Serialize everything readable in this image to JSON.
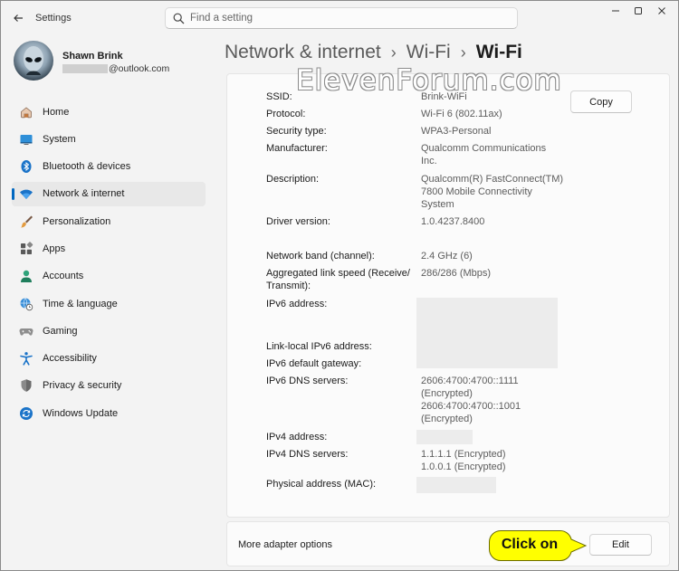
{
  "app": {
    "title": "Settings",
    "search_placeholder": "Find a setting"
  },
  "profile": {
    "name": "Shawn Brink",
    "email_suffix": "@outlook.com"
  },
  "sidebar": {
    "active_index": 3,
    "items": [
      {
        "label": "Home",
        "icon": "home-icon"
      },
      {
        "label": "System",
        "icon": "system-icon"
      },
      {
        "label": "Bluetooth & devices",
        "icon": "bluetooth-icon"
      },
      {
        "label": "Network & internet",
        "icon": "wifi-icon"
      },
      {
        "label": "Personalization",
        "icon": "brush-icon"
      },
      {
        "label": "Apps",
        "icon": "apps-icon"
      },
      {
        "label": "Accounts",
        "icon": "accounts-icon"
      },
      {
        "label": "Time & language",
        "icon": "globe-clock-icon"
      },
      {
        "label": "Gaming",
        "icon": "gamepad-icon"
      },
      {
        "label": "Accessibility",
        "icon": "accessibility-icon"
      },
      {
        "label": "Privacy & security",
        "icon": "shield-icon"
      },
      {
        "label": "Windows Update",
        "icon": "update-icon"
      }
    ]
  },
  "breadcrumb": {
    "level1": "Network & internet",
    "level2": "Wi-Fi",
    "current": "Wi-Fi",
    "separator": "›"
  },
  "watermark": "ElevenForum.com",
  "properties": {
    "ssid": {
      "label": "SSID:",
      "value": "Brink-WiFi"
    },
    "protocol": {
      "label": "Protocol:",
      "value": "Wi-Fi 6 (802.11ax)"
    },
    "security": {
      "label": "Security type:",
      "value": "WPA3-Personal"
    },
    "manufacturer": {
      "label": "Manufacturer:",
      "value_line1": "Qualcomm Communications",
      "value_line2": "Inc."
    },
    "description": {
      "label": "Description:",
      "value_line1": "Qualcomm(R) FastConnect(TM)",
      "value_line2": "7800 Mobile Connectivity",
      "value_line3": "System"
    },
    "driver": {
      "label": "Driver version:",
      "value": "1.0.4237.8400"
    },
    "band": {
      "label": "Network band (channel):",
      "value": "2.4 GHz (6)"
    },
    "link_speed": {
      "label_line1": "Aggregated link speed (Receive/",
      "label_line2": "Transmit):",
      "value": "286/286 (Mbps)"
    },
    "ipv6": {
      "label": "IPv6 address:"
    },
    "link_local_ipv6": {
      "label": "Link-local IPv6 address:"
    },
    "ipv6_gateway": {
      "label": "IPv6 default gateway:"
    },
    "ipv6_dns": {
      "label": "IPv6 DNS servers:",
      "line1": "2606:4700:4700::1111",
      "line2": "(Encrypted)",
      "line3": "2606:4700:4700::1001",
      "line4": "(Encrypted)"
    },
    "ipv4": {
      "label": "IPv4 address:"
    },
    "ipv4_dns": {
      "label": "IPv4 DNS servers:",
      "line1": "1.1.1.1 (Encrypted)",
      "line2": "1.0.0.1 (Encrypted)"
    },
    "mac": {
      "label": "Physical address (MAC):"
    }
  },
  "buttons": {
    "copy": "Copy",
    "edit": "Edit"
  },
  "adapter": {
    "label": "More adapter options"
  },
  "callout": {
    "text": "Click on",
    "color": "#ffff00"
  }
}
